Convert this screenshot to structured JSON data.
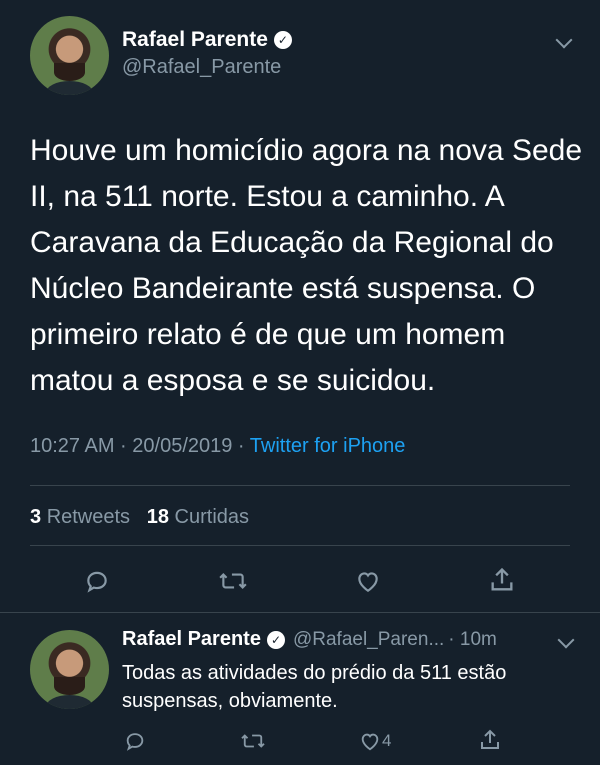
{
  "tweet": {
    "author_name": "Rafael Parente",
    "author_handle": "@Rafael_Parente",
    "text": "Houve um homicídio agora na nova Sede II, na 511 norte. Estou a caminho. A Caravana da Educação da Regional do Núcleo Bandeirante está suspensa. O primeiro relato é de que um homem matou a esposa e se suicidou.",
    "timestamp": "10:27 AM · 20/05/2019 · ",
    "source": "Twitter for iPhone",
    "retweets_count": "3",
    "retweets_label": "Retweets",
    "likes_count": "18",
    "likes_label": "Curtidas"
  },
  "reply": {
    "author_name": "Rafael Parente",
    "author_handle": "@Rafael_Paren...",
    "time": "· 10m",
    "text": "Todas as atividades do prédio da 511 estão suspensas, obviamente.",
    "likes_count": "4"
  },
  "icons": [
    "verified-badge-icon",
    "chevron-down-icon",
    "reply-icon",
    "retweet-icon",
    "like-icon",
    "share-icon"
  ],
  "colors": {
    "background": "#15202b",
    "accent": "#1da1f2",
    "secondary_text": "#8899a6",
    "divider": "#38444d"
  }
}
